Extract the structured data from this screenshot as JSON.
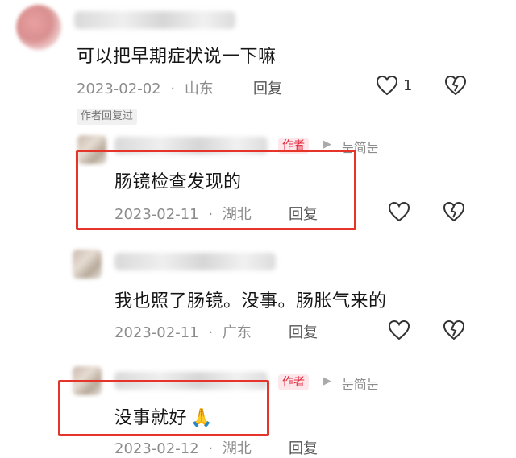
{
  "comment": {
    "text": "可以把早期症状说一下嘛",
    "date": "2023-02-02",
    "location": "山东",
    "reply_label": "回复",
    "like_count": "1",
    "author_replied_tag": "作者回复过"
  },
  "replies": [
    {
      "badge": "作者",
      "reply_to": "눈简눈",
      "text": "肠镜检查发现的",
      "date": "2023-02-11",
      "location": "湖北",
      "reply_label": "回复"
    },
    {
      "text": "我也照了肠镜。没事。肠胀气来的",
      "date": "2023-02-11",
      "location": "广东",
      "reply_label": "回复"
    },
    {
      "badge": "作者",
      "reply_to": "눈简눈",
      "text": "没事就好",
      "emoji": "🙏",
      "date": "2023-02-12",
      "location": "湖北",
      "reply_label": "回复"
    }
  ],
  "separator": "·",
  "colors": {
    "highlight_box": "#e5352b",
    "badge_red": "#e1243a"
  },
  "icons": [
    "heart-icon",
    "broken-heart-icon",
    "triangle-arrow-icon"
  ]
}
